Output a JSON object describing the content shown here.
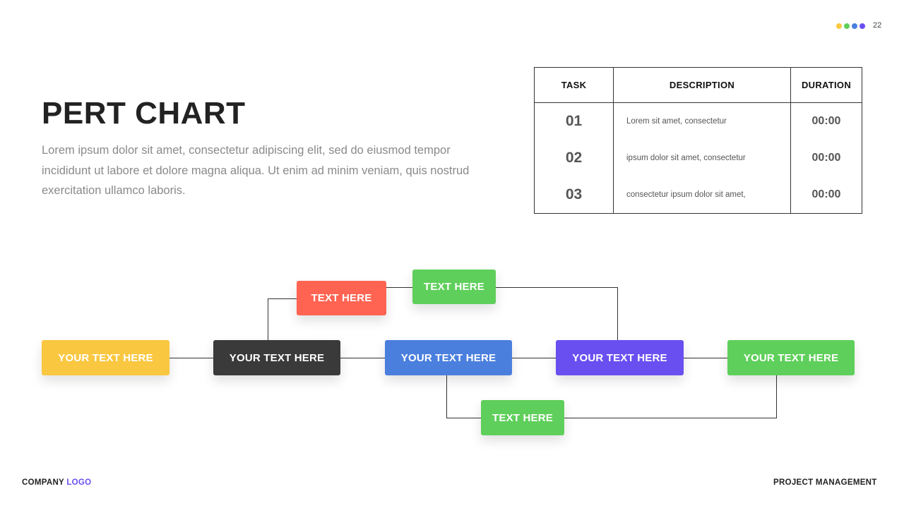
{
  "header": {
    "page_number": "22",
    "dots": [
      "#f9c740",
      "#5fcf5b",
      "#4a7fde",
      "#6a4ff0"
    ]
  },
  "slide": {
    "title": "PERT CHART",
    "body": "Lorem ipsum dolor sit amet, consectetur adipiscing elit, sed do eiusmod tempor incididunt ut labore et dolore magna aliqua. Ut enim ad minim veniam, quis nostrud exercitation ullamco laboris."
  },
  "table": {
    "headers": [
      "TASK",
      "DESCRIPTION",
      "DURATION"
    ],
    "rows": [
      {
        "task": "01",
        "description": "Lorem sit amet, consectetur",
        "duration": "00:00"
      },
      {
        "task": "02",
        "description": "ipsum dolor sit amet, consectetur",
        "duration": "00:00"
      },
      {
        "task": "03",
        "description": "consectetur ipsum  dolor  sit amet,",
        "duration": "00:00"
      }
    ]
  },
  "diagram": {
    "nodes": [
      {
        "id": "n1",
        "label": "YOUR TEXT HERE",
        "color": "#f9c740"
      },
      {
        "id": "n2",
        "label": "YOUR TEXT HERE",
        "color": "#3a3a3a"
      },
      {
        "id": "n3",
        "label": "YOUR TEXT HERE",
        "color": "#4a7fde"
      },
      {
        "id": "n4",
        "label": "YOUR TEXT HERE",
        "color": "#6a4ff0"
      },
      {
        "id": "n5",
        "label": "YOUR TEXT HERE",
        "color": "#5fcf5b"
      },
      {
        "id": "t1",
        "label": "TEXT HERE",
        "color": "#ff6452"
      },
      {
        "id": "t2",
        "label": "TEXT HERE",
        "color": "#5fcf5b"
      },
      {
        "id": "t3",
        "label": "TEXT HERE",
        "color": "#5fcf5b"
      }
    ],
    "edges": [
      [
        "n1",
        "n2"
      ],
      [
        "n2",
        "n3"
      ],
      [
        "n3",
        "n4"
      ],
      [
        "n4",
        "n5"
      ],
      [
        "n2",
        "t1"
      ],
      [
        "t1",
        "t2"
      ],
      [
        "t2",
        "n4"
      ],
      [
        "n3",
        "t3"
      ],
      [
        "t3",
        "n5"
      ]
    ]
  },
  "footer": {
    "company": "COMPANY",
    "logo": "LOGO",
    "section": "PROJECT MANAGEMENT"
  }
}
